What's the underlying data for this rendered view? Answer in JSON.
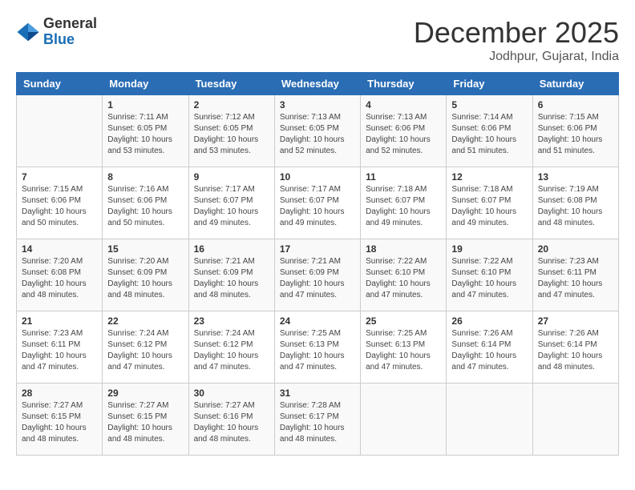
{
  "header": {
    "logo_general": "General",
    "logo_blue": "Blue",
    "month_year": "December 2025",
    "location": "Jodhpur, Gujarat, India"
  },
  "weekdays": [
    "Sunday",
    "Monday",
    "Tuesday",
    "Wednesday",
    "Thursday",
    "Friday",
    "Saturday"
  ],
  "weeks": [
    [
      {
        "day": "",
        "content": ""
      },
      {
        "day": "1",
        "content": "Sunrise: 7:11 AM\nSunset: 6:05 PM\nDaylight: 10 hours\nand 53 minutes."
      },
      {
        "day": "2",
        "content": "Sunrise: 7:12 AM\nSunset: 6:05 PM\nDaylight: 10 hours\nand 53 minutes."
      },
      {
        "day": "3",
        "content": "Sunrise: 7:13 AM\nSunset: 6:05 PM\nDaylight: 10 hours\nand 52 minutes."
      },
      {
        "day": "4",
        "content": "Sunrise: 7:13 AM\nSunset: 6:06 PM\nDaylight: 10 hours\nand 52 minutes."
      },
      {
        "day": "5",
        "content": "Sunrise: 7:14 AM\nSunset: 6:06 PM\nDaylight: 10 hours\nand 51 minutes."
      },
      {
        "day": "6",
        "content": "Sunrise: 7:15 AM\nSunset: 6:06 PM\nDaylight: 10 hours\nand 51 minutes."
      }
    ],
    [
      {
        "day": "7",
        "content": "Sunrise: 7:15 AM\nSunset: 6:06 PM\nDaylight: 10 hours\nand 50 minutes."
      },
      {
        "day": "8",
        "content": "Sunrise: 7:16 AM\nSunset: 6:06 PM\nDaylight: 10 hours\nand 50 minutes."
      },
      {
        "day": "9",
        "content": "Sunrise: 7:17 AM\nSunset: 6:07 PM\nDaylight: 10 hours\nand 49 minutes."
      },
      {
        "day": "10",
        "content": "Sunrise: 7:17 AM\nSunset: 6:07 PM\nDaylight: 10 hours\nand 49 minutes."
      },
      {
        "day": "11",
        "content": "Sunrise: 7:18 AM\nSunset: 6:07 PM\nDaylight: 10 hours\nand 49 minutes."
      },
      {
        "day": "12",
        "content": "Sunrise: 7:18 AM\nSunset: 6:07 PM\nDaylight: 10 hours\nand 49 minutes."
      },
      {
        "day": "13",
        "content": "Sunrise: 7:19 AM\nSunset: 6:08 PM\nDaylight: 10 hours\nand 48 minutes."
      }
    ],
    [
      {
        "day": "14",
        "content": "Sunrise: 7:20 AM\nSunset: 6:08 PM\nDaylight: 10 hours\nand 48 minutes."
      },
      {
        "day": "15",
        "content": "Sunrise: 7:20 AM\nSunset: 6:09 PM\nDaylight: 10 hours\nand 48 minutes."
      },
      {
        "day": "16",
        "content": "Sunrise: 7:21 AM\nSunset: 6:09 PM\nDaylight: 10 hours\nand 48 minutes."
      },
      {
        "day": "17",
        "content": "Sunrise: 7:21 AM\nSunset: 6:09 PM\nDaylight: 10 hours\nand 47 minutes."
      },
      {
        "day": "18",
        "content": "Sunrise: 7:22 AM\nSunset: 6:10 PM\nDaylight: 10 hours\nand 47 minutes."
      },
      {
        "day": "19",
        "content": "Sunrise: 7:22 AM\nSunset: 6:10 PM\nDaylight: 10 hours\nand 47 minutes."
      },
      {
        "day": "20",
        "content": "Sunrise: 7:23 AM\nSunset: 6:11 PM\nDaylight: 10 hours\nand 47 minutes."
      }
    ],
    [
      {
        "day": "21",
        "content": "Sunrise: 7:23 AM\nSunset: 6:11 PM\nDaylight: 10 hours\nand 47 minutes."
      },
      {
        "day": "22",
        "content": "Sunrise: 7:24 AM\nSunset: 6:12 PM\nDaylight: 10 hours\nand 47 minutes."
      },
      {
        "day": "23",
        "content": "Sunrise: 7:24 AM\nSunset: 6:12 PM\nDaylight: 10 hours\nand 47 minutes."
      },
      {
        "day": "24",
        "content": "Sunrise: 7:25 AM\nSunset: 6:13 PM\nDaylight: 10 hours\nand 47 minutes."
      },
      {
        "day": "25",
        "content": "Sunrise: 7:25 AM\nSunset: 6:13 PM\nDaylight: 10 hours\nand 47 minutes."
      },
      {
        "day": "26",
        "content": "Sunrise: 7:26 AM\nSunset: 6:14 PM\nDaylight: 10 hours\nand 47 minutes."
      },
      {
        "day": "27",
        "content": "Sunrise: 7:26 AM\nSunset: 6:14 PM\nDaylight: 10 hours\nand 48 minutes."
      }
    ],
    [
      {
        "day": "28",
        "content": "Sunrise: 7:27 AM\nSunset: 6:15 PM\nDaylight: 10 hours\nand 48 minutes."
      },
      {
        "day": "29",
        "content": "Sunrise: 7:27 AM\nSunset: 6:15 PM\nDaylight: 10 hours\nand 48 minutes."
      },
      {
        "day": "30",
        "content": "Sunrise: 7:27 AM\nSunset: 6:16 PM\nDaylight: 10 hours\nand 48 minutes."
      },
      {
        "day": "31",
        "content": "Sunrise: 7:28 AM\nSunset: 6:17 PM\nDaylight: 10 hours\nand 48 minutes."
      },
      {
        "day": "",
        "content": ""
      },
      {
        "day": "",
        "content": ""
      },
      {
        "day": "",
        "content": ""
      }
    ]
  ]
}
